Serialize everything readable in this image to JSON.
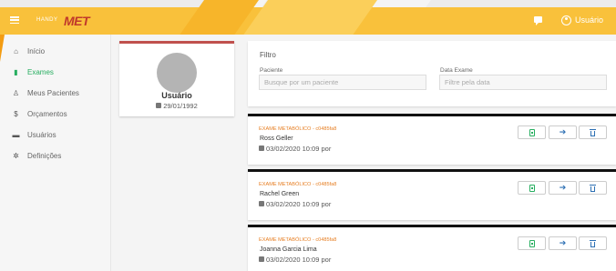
{
  "header": {
    "brand_small": "HANDY",
    "brand_logo": "MET",
    "user_name": "Usuário",
    "icons": {
      "menu": "hamburger-icon",
      "chat": "chat-icon",
      "user": "user-circle-icon"
    }
  },
  "sidebar": {
    "items": [
      {
        "label": "Início",
        "icon": "home-icon",
        "glyph": "⌂",
        "active": false
      },
      {
        "label": "Exames",
        "icon": "book-icon",
        "glyph": "▮",
        "active": true
      },
      {
        "label": "Meus Pacientes",
        "icon": "users-icon",
        "glyph": "♙",
        "active": false
      },
      {
        "label": "Orçamentos",
        "icon": "dollar-icon",
        "glyph": "$",
        "active": false
      },
      {
        "label": "Usuários",
        "icon": "briefcase-icon",
        "glyph": "▬",
        "active": false
      },
      {
        "label": "Definições",
        "icon": "gear-icon",
        "glyph": "✲",
        "active": false
      }
    ]
  },
  "profile": {
    "name": "Usuário",
    "date": "29/01/1992"
  },
  "filter": {
    "title": "Filtro",
    "patient_label": "Paciente",
    "patient_placeholder": "Busque por um paciente",
    "date_label": "Data Exame",
    "date_placeholder": "Filtre pela data"
  },
  "exams": [
    {
      "type": "EXAME METABÓLICO - c0485fa8",
      "patient": "Ross Geller",
      "date": "03/02/2020 10:09 por"
    },
    {
      "type": "EXAME METABÓLICO - c0485fa8",
      "patient": "Rachel Green",
      "date": "03/02/2020 10:09 por"
    },
    {
      "type": "EXAME METABÓLICO - c0485fa8",
      "patient": "Joanna Garcia Lima",
      "date": "03/02/2020 10:09 por"
    }
  ],
  "colors": {
    "header": "#f9c13b",
    "active": "#27ae60",
    "exam_type": "#e67e22",
    "action": "#2c6fb3"
  }
}
